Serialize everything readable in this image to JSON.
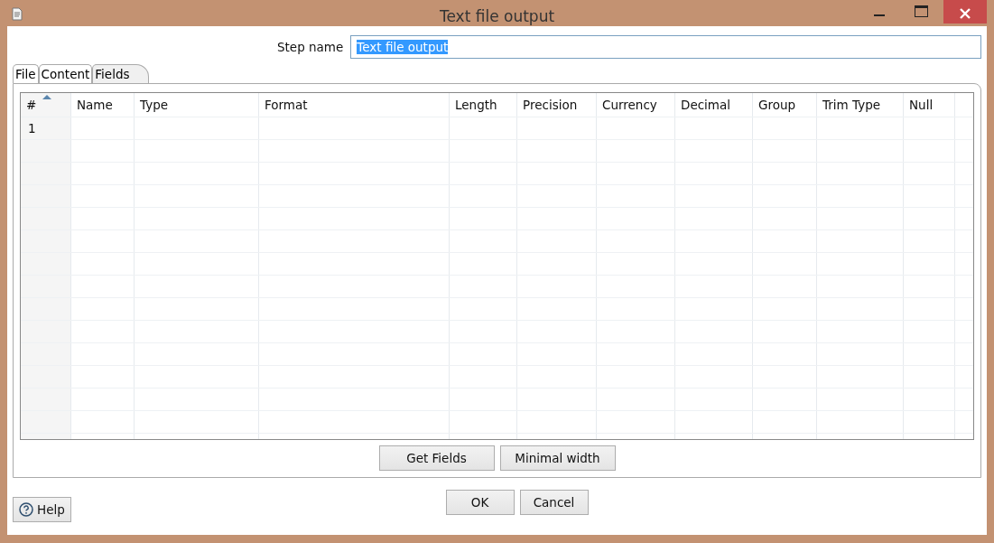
{
  "window": {
    "title": "Text file output"
  },
  "step_name": {
    "label": "Step name",
    "value": "Text file output"
  },
  "tabs": [
    {
      "label": "File",
      "selected": false
    },
    {
      "label": "Content",
      "selected": false
    },
    {
      "label": "Fields",
      "selected": true
    }
  ],
  "table": {
    "columns": [
      "#",
      "Name",
      "Type",
      "Format",
      "Length",
      "Precision",
      "Currency",
      "Decimal",
      "Group",
      "Trim Type",
      "Null"
    ],
    "rows": [
      [
        "1",
        "",
        "",
        "",
        "",
        "",
        "",
        "",
        "",
        "",
        ""
      ]
    ]
  },
  "table_buttons": [
    "Get Fields",
    "Minimal width"
  ],
  "dialog_buttons": [
    "OK",
    "Cancel"
  ],
  "help_button": "Help"
}
